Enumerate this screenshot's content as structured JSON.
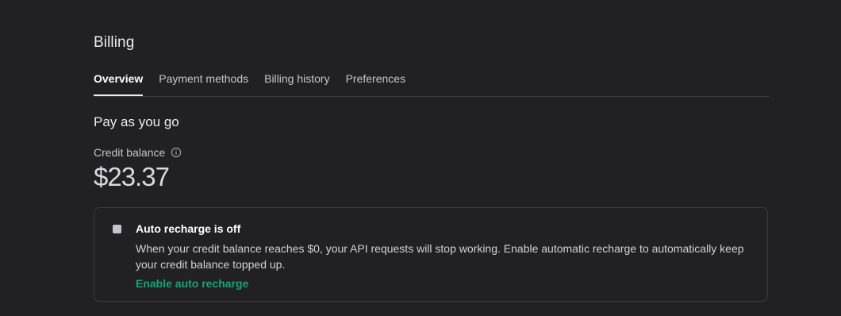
{
  "page": {
    "title": "Billing"
  },
  "tabs": [
    {
      "label": "Overview",
      "active": true
    },
    {
      "label": "Payment methods",
      "active": false
    },
    {
      "label": "Billing history",
      "active": false
    },
    {
      "label": "Preferences",
      "active": false
    }
  ],
  "plan": {
    "title": "Pay as you go",
    "credit_label": "Credit balance",
    "credit_info_icon": "info-icon",
    "balance": "$23.37"
  },
  "notice": {
    "icon": "stop-square-icon",
    "title": "Auto recharge is off",
    "body": "When your credit balance reaches $0, your API requests will stop working. Enable automatic recharge to automatically keep your credit balance topped up.",
    "link_label": "Enable auto recharge"
  },
  "colors": {
    "background": "#212123",
    "accent_link": "#19a27c",
    "border": "#3b3b3f"
  }
}
